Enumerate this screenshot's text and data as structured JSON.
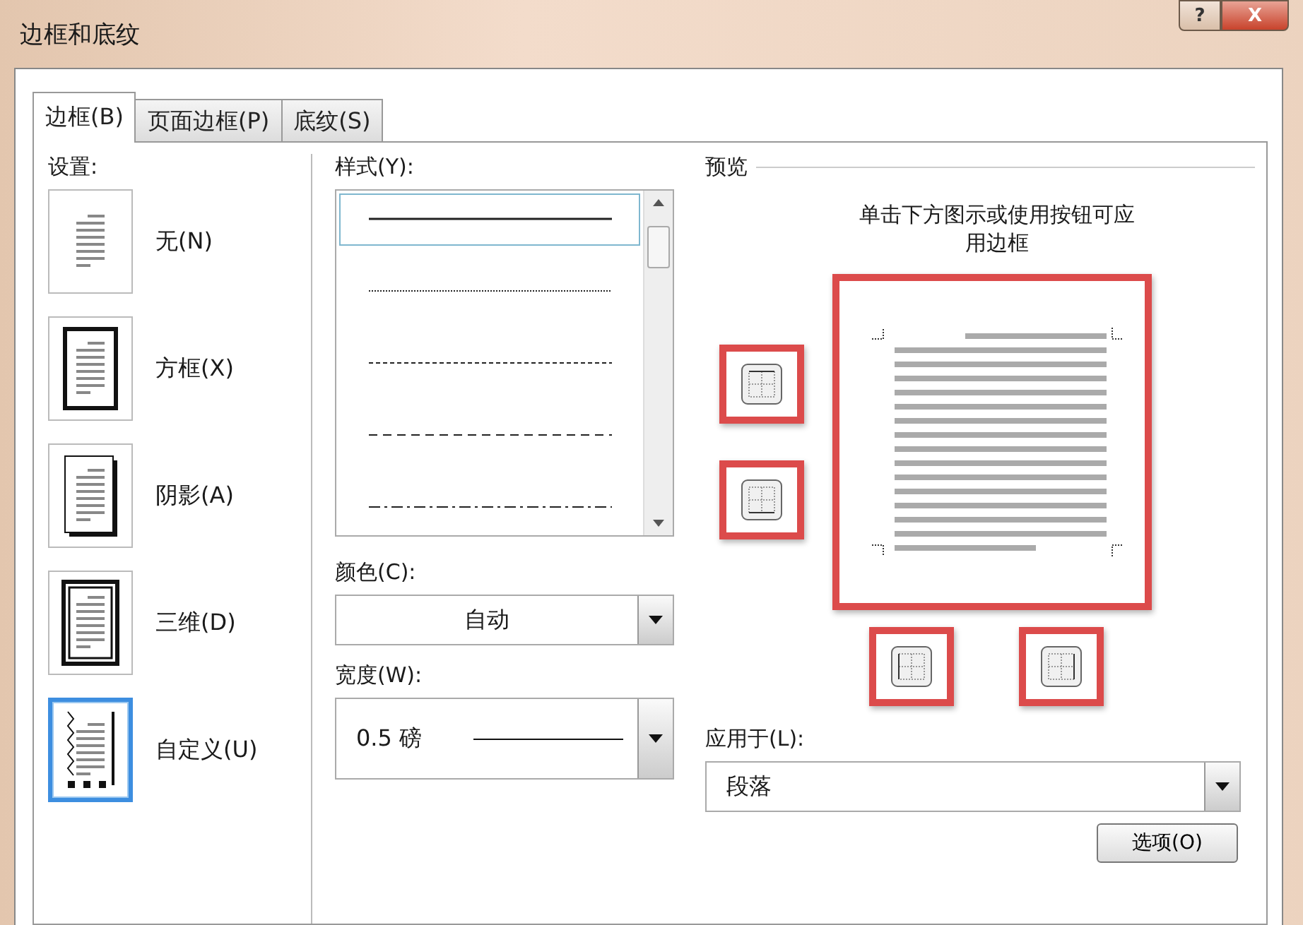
{
  "window": {
    "title": "边框和底纹",
    "help_button": "?",
    "close_button": "X"
  },
  "tabs": [
    {
      "label": "边框(B)",
      "selected": true
    },
    {
      "label": "页面边框(P)",
      "selected": false
    },
    {
      "label": "底纹(S)",
      "selected": false
    }
  ],
  "settings": {
    "label": "设置:",
    "items": [
      {
        "label": "无(N)",
        "kind": "none",
        "selected": false
      },
      {
        "label": "方框(X)",
        "kind": "box",
        "selected": false
      },
      {
        "label": "阴影(A)",
        "kind": "shadow",
        "selected": false
      },
      {
        "label": "三维(D)",
        "kind": "raised",
        "selected": false
      },
      {
        "label": "自定义(U)",
        "kind": "custom",
        "selected": true
      }
    ]
  },
  "style": {
    "label": "样式(Y):",
    "items": [
      {
        "kind": "solid",
        "selected": true
      },
      {
        "kind": "dotted",
        "selected": false
      },
      {
        "kind": "fine-dash",
        "selected": false
      },
      {
        "kind": "dash",
        "selected": false
      },
      {
        "kind": "dash-dot",
        "selected": false
      }
    ]
  },
  "color": {
    "label": "颜色(C):",
    "value": "自动"
  },
  "width": {
    "label": "宽度(W):",
    "value": "0.5 磅"
  },
  "preview": {
    "title": "预览",
    "hint": "单击下方图示或使用按钮可应用边框",
    "highlighted": true,
    "side_buttons": [
      {
        "kind": "top",
        "highlighted": true
      },
      {
        "kind": "bottom",
        "highlighted": true
      }
    ],
    "bottom_buttons": [
      {
        "kind": "left",
        "highlighted": true
      },
      {
        "kind": "right",
        "highlighted": true
      }
    ]
  },
  "apply_to": {
    "label": "应用于(L):",
    "value": "段落"
  },
  "options_button": "选项(O)"
}
